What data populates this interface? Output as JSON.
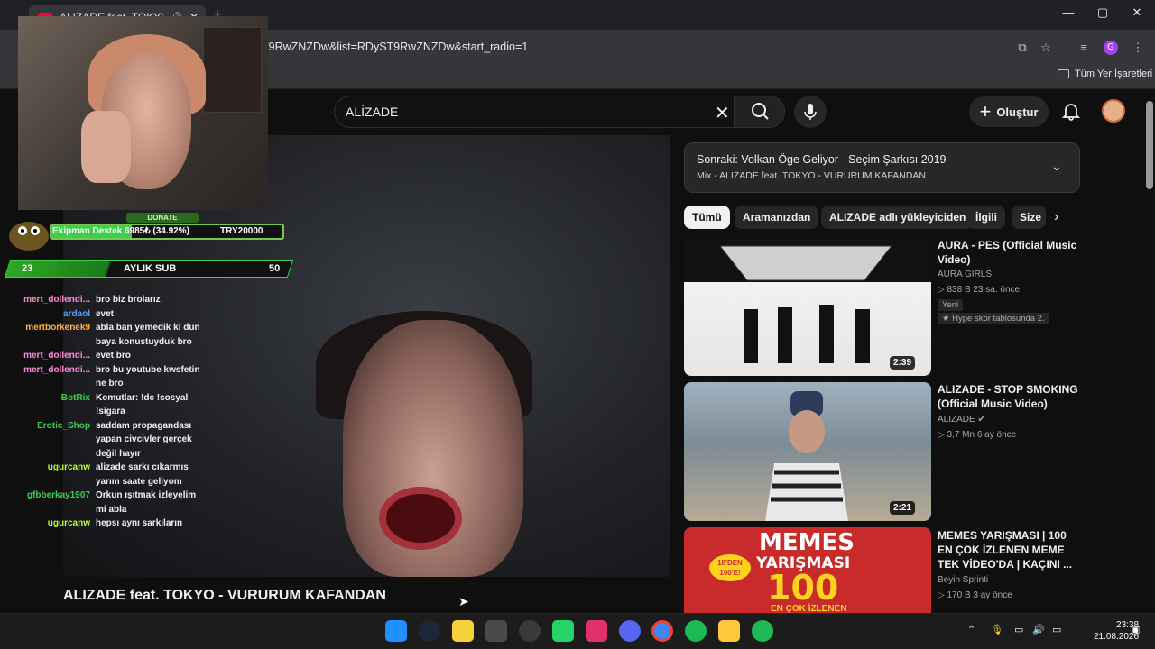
{
  "browser": {
    "tab_title": "ALIZADE feat. TOKYO - VU",
    "url": "T9RwZNZDw&list=RDyST9RwZNZDw&start_radio=1",
    "bookmarks_label": "Tüm Yer İşaretleri",
    "profile_initial": "G"
  },
  "youtube": {
    "search_value": "ALİZADE",
    "create_label": "Oluştur",
    "video_title": "ALIZADE feat. TOKYO - VURURUM KAFANDAN",
    "next_up": {
      "title": "Sonraki: Volkan Öge Geliyor - Seçim Şarkısı 2019",
      "subtitle": "Mix - ALIZADE feat. TOKYO - VURURUM KAFANDAN"
    },
    "chips": [
      "Tümü",
      "Aramanızdan",
      "ALIZADE adlı yükleyiciden",
      "İlgili",
      "Size"
    ],
    "videos": [
      {
        "title": "AURA - PES (Official Music Video)",
        "channel": "AURA GIRLS",
        "views": "838 B",
        "age": "23 sa. önce",
        "badge": "Yeni",
        "extra": "Hype skor tablosunda 2.",
        "duration": "2:39"
      },
      {
        "title": "ALIZADE - STOP SMOKING (Official Music Video)",
        "channel": "ALIZADE",
        "views": "3,7 Mn",
        "age": "6 ay önce",
        "duration": "2:21"
      },
      {
        "title": "MEMES YARIŞMASI | 100 EN ÇOK İZLENEN MEME TEK VİDEO'DA | KAÇINI ...",
        "channel": "Beyin Sprinti",
        "views": "170 B",
        "age": "3 ay önce",
        "thumb_text1": "MEMES",
        "thumb_text2": "YARIŞMASI",
        "thumb_text3": "100",
        "thumb_text4": "EN ÇOK İZLENEN",
        "thumb_badge": "18'DEN 100'E!"
      }
    ]
  },
  "overlay": {
    "donate_title": "DONATE",
    "donate_label": "Ekipman Destek",
    "donate_amount": "6985₺ (34.92%)",
    "donate_goal": "TRY20000",
    "donate_progress": 34.92,
    "sub_left": "23",
    "sub_label": "AYLIK SUB",
    "sub_right": "50",
    "chat": [
      {
        "name": "mert_dollendi...",
        "msg": "bro biz brolarız",
        "color": "#ff8ad8"
      },
      {
        "name": "ardaol",
        "msg": "evet",
        "color": "#5aa0ff"
      },
      {
        "name": "mertborkenek9",
        "msg": "abla ban yemedik ki dün baya konustuyduk bro",
        "color": "#ffb14a"
      },
      {
        "name": "mert_dollendi...",
        "msg": "evet bro",
        "color": "#ff8ad8"
      },
      {
        "name": "mert_dollendi...",
        "msg": "bro bu youtube kwsfetin ne bro",
        "color": "#ff8ad8"
      },
      {
        "name": "BotRix",
        "msg": "Komutlar: !dc !sosyal !sigara",
        "color": "#3ccf4e"
      },
      {
        "name": "Erotic_Shop",
        "msg": "saddam propagandası yapan civcivler gerçek değil hayır",
        "color": "#3ccf4e"
      },
      {
        "name": "ugurcanw",
        "msg": "alizade sarkı cıkarmıs yarım saate geliyom",
        "color": "#b8ff3a"
      },
      {
        "name": "gfbberkay1907",
        "msg": "Orkun ışıtmak izleyelim mi abla",
        "color": "#3ccf4e"
      },
      {
        "name": "ugurcanw",
        "msg": "hepsı aynı sarkıların",
        "color": "#b8ff3a"
      }
    ]
  },
  "taskbar": {
    "time": "23:38",
    "date": "21.08.2026"
  }
}
